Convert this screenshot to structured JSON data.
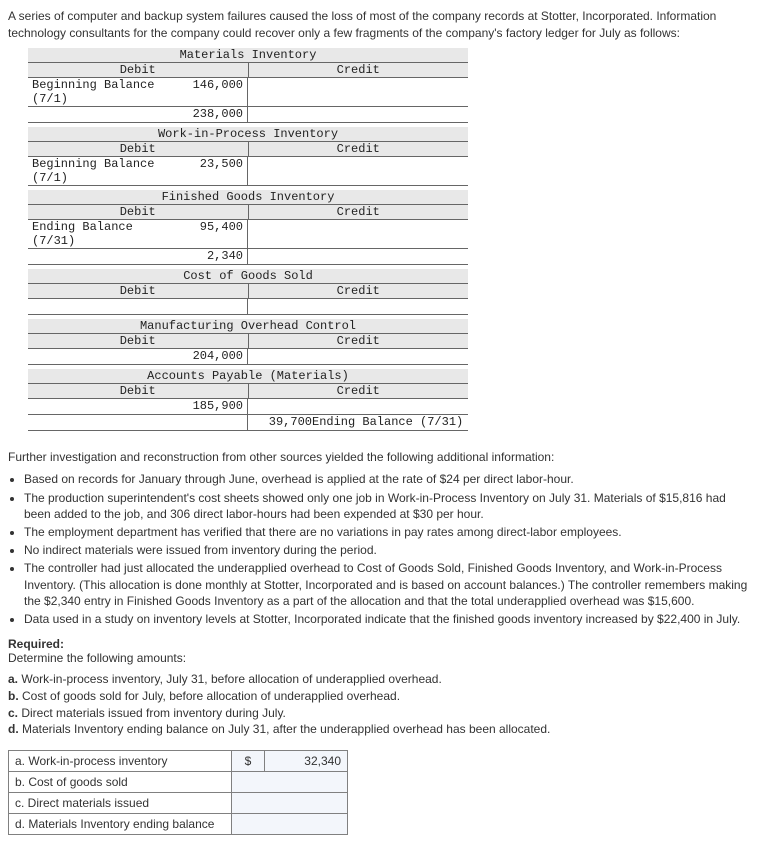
{
  "intro": "A series of computer and backup system failures caused the loss of most of the company records at Stotter, Incorporated. Information technology consultants for the company could recover only a few fragments of the company's factory ledger for July as follows:",
  "taccounts": [
    {
      "title": "Materials Inventory",
      "debit_label": "Debit",
      "credit_label": "Credit",
      "rows": [
        {
          "left_label": "Beginning Balance (7/1)",
          "left_amt": "146,000",
          "right_label": "",
          "right_amt": ""
        },
        {
          "left_label": "",
          "left_amt": "238,000",
          "right_label": "",
          "right_amt": ""
        }
      ]
    },
    {
      "title": "Work-in-Process Inventory",
      "debit_label": "Debit",
      "credit_label": "Credit",
      "rows": [
        {
          "left_label": "Beginning Balance (7/1)",
          "left_amt": "23,500",
          "right_label": "",
          "right_amt": ""
        }
      ]
    },
    {
      "title": "Finished Goods Inventory",
      "debit_label": "Debit",
      "credit_label": "Credit",
      "rows": [
        {
          "left_label": "Ending Balance (7/31)",
          "left_amt": "95,400",
          "right_label": "",
          "right_amt": ""
        },
        {
          "left_label": "",
          "left_amt": "2,340",
          "right_label": "",
          "right_amt": ""
        }
      ]
    },
    {
      "title": "Cost of Goods Sold",
      "debit_label": "Debit",
      "credit_label": "Credit",
      "rows": [
        {
          "left_label": "",
          "left_amt": "",
          "right_label": "",
          "right_amt": ""
        }
      ]
    },
    {
      "title": "Manufacturing Overhead Control",
      "debit_label": "Debit",
      "credit_label": "Credit",
      "rows": [
        {
          "left_label": "",
          "left_amt": "204,000",
          "right_label": "",
          "right_amt": ""
        }
      ]
    },
    {
      "title": "Accounts Payable (Materials)",
      "debit_label": "Debit",
      "credit_label": "Credit",
      "rows": [
        {
          "left_label": "",
          "left_amt": "185,900",
          "right_label": "",
          "right_amt": ""
        },
        {
          "left_label": "",
          "left_amt": "",
          "right_label": "Ending Balance (7/31)",
          "right_amt": "39,700"
        }
      ]
    }
  ],
  "further": "Further investigation and reconstruction from other sources yielded the following additional information:",
  "bullets": [
    "Based on records for January through June, overhead is applied at the rate of $24 per direct labor-hour.",
    "The production superintendent's cost sheets showed only one job in Work-in-Process Inventory on July 31. Materials of $15,816 had been added to the job, and 306 direct labor-hours had been expended at $30 per hour.",
    "The employment department has verified that there are no variations in pay rates among direct-labor employees.",
    "No indirect materials were issued from inventory during the period.",
    "The controller had just allocated the underapplied overhead to Cost of Goods Sold, Finished Goods Inventory, and Work-in-Process Inventory. (This allocation is done monthly at Stotter, Incorporated and is based on account balances.) The controller remembers making the $2,340 entry in Finished Goods Inventory as a part of the allocation and that the total underapplied overhead was $15,600.",
    "Data used in a study on inventory levels at Stotter, Incorporated indicate that the finished goods inventory increased by $22,400 in July."
  ],
  "required_head": "Required:",
  "required_body": "Determine the following amounts:",
  "abcd": [
    "a. Work-in-process inventory, July 31, before allocation of underapplied overhead.",
    "b. Cost of goods sold for July, before allocation of underapplied overhead.",
    "c. Direct materials issued from inventory during July.",
    "d. Materials Inventory ending balance on July 31, after the underapplied overhead has been allocated."
  ],
  "answer_table": {
    "rows": [
      {
        "label": "a. Work-in-process inventory",
        "sym": "$",
        "val": "32,340"
      },
      {
        "label": "b. Cost of goods sold",
        "sym": "",
        "val": ""
      },
      {
        "label": "c. Direct materials issued",
        "sym": "",
        "val": ""
      },
      {
        "label": "d. Materials Inventory ending balance",
        "sym": "",
        "val": ""
      }
    ]
  }
}
